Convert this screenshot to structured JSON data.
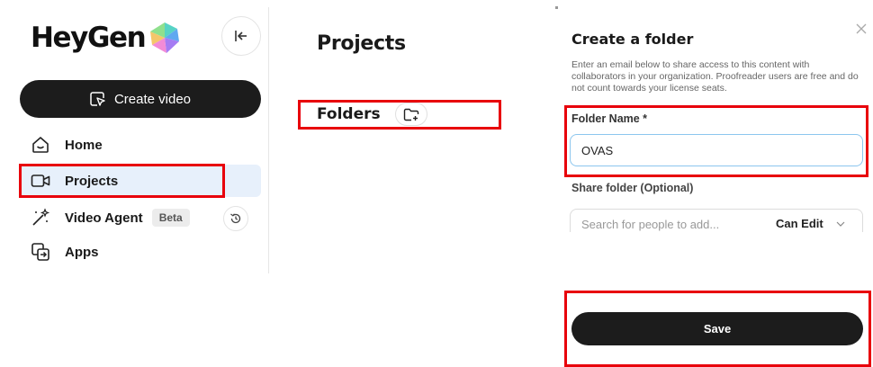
{
  "sidebar": {
    "brand": "HeyGen",
    "create_label": "Create video",
    "items": [
      {
        "label": "Home",
        "icon": "home-icon"
      },
      {
        "label": "Projects",
        "icon": "video-camera-icon",
        "active": true
      },
      {
        "label": "Video Agent",
        "icon": "magic-wand-icon",
        "badge": "Beta"
      },
      {
        "label": "Apps",
        "icon": "apps-icon"
      }
    ]
  },
  "main": {
    "title": "Projects",
    "folders_label": "Folders"
  },
  "dialog": {
    "title": "Create a folder",
    "description": "Enter an email below to share access to this content with collaborators in your organization. Proofreader users are free and do not count towards your license seats.",
    "folder_name_label": "Folder Name *",
    "folder_name_value": "OVAS",
    "share_label": "Share folder (Optional)",
    "share_placeholder": "Search for people to add...",
    "permission": "Can Edit",
    "save_label": "Save"
  },
  "colors": {
    "highlight": "#e8000b",
    "active_nav": "#e7f0fb",
    "primary_button": "#1c1c1c",
    "input_focus": "#8cc6ee"
  }
}
